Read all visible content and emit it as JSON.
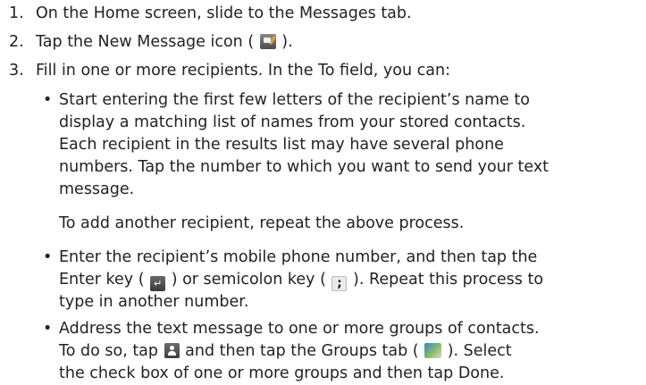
{
  "steps": [
    {
      "num": "1.",
      "text_a": "On the Home screen, slide to the Messages tab."
    },
    {
      "num": "2.",
      "text_a": "Tap the ",
      "bold": "New Message",
      "text_b": " icon ( ",
      "icon": "new-message-icon",
      "text_c": " )."
    },
    {
      "num": "3.",
      "text_a": "Fill in one or more recipients. In the ",
      "bold": "To",
      "text_b": " field, you can:"
    }
  ],
  "bullets": [
    {
      "marker": "•",
      "lines": [
        "Start entering the first few letters of the recipient’s name to",
        "display a matching list of names from your stored contacts.",
        "Each recipient in the results list may have several phone",
        "numbers. Tap the number to which you want to send your text",
        "message."
      ],
      "note": "To add another recipient, repeat the above process."
    },
    {
      "marker": "•",
      "l1": "Enter the recipient’s mobile phone number, and then tap the",
      "l2_a": "Enter key ( ",
      "l2_icon1": "enter-key-icon",
      "l2_b": " ) or semicolon key ( ",
      "l2_icon2": "semicolon-key-icon",
      "l2_icon2_glyph": ";",
      "l2_c": " ). Repeat this process to",
      "l3": "type in another number."
    },
    {
      "marker": "•",
      "l1": "Address the text message to one or more groups of contacts.",
      "l2_a": "To do so, tap ",
      "l2_icon1": "contacts-icon",
      "l2_b": " and then tap the Groups tab ( ",
      "l2_icon2": "groups-tab-icon",
      "l2_c": " ). Select",
      "l3_a": "the check box of one or more groups and then tap ",
      "l3_bold": "Done",
      "l3_b": "."
    }
  ]
}
